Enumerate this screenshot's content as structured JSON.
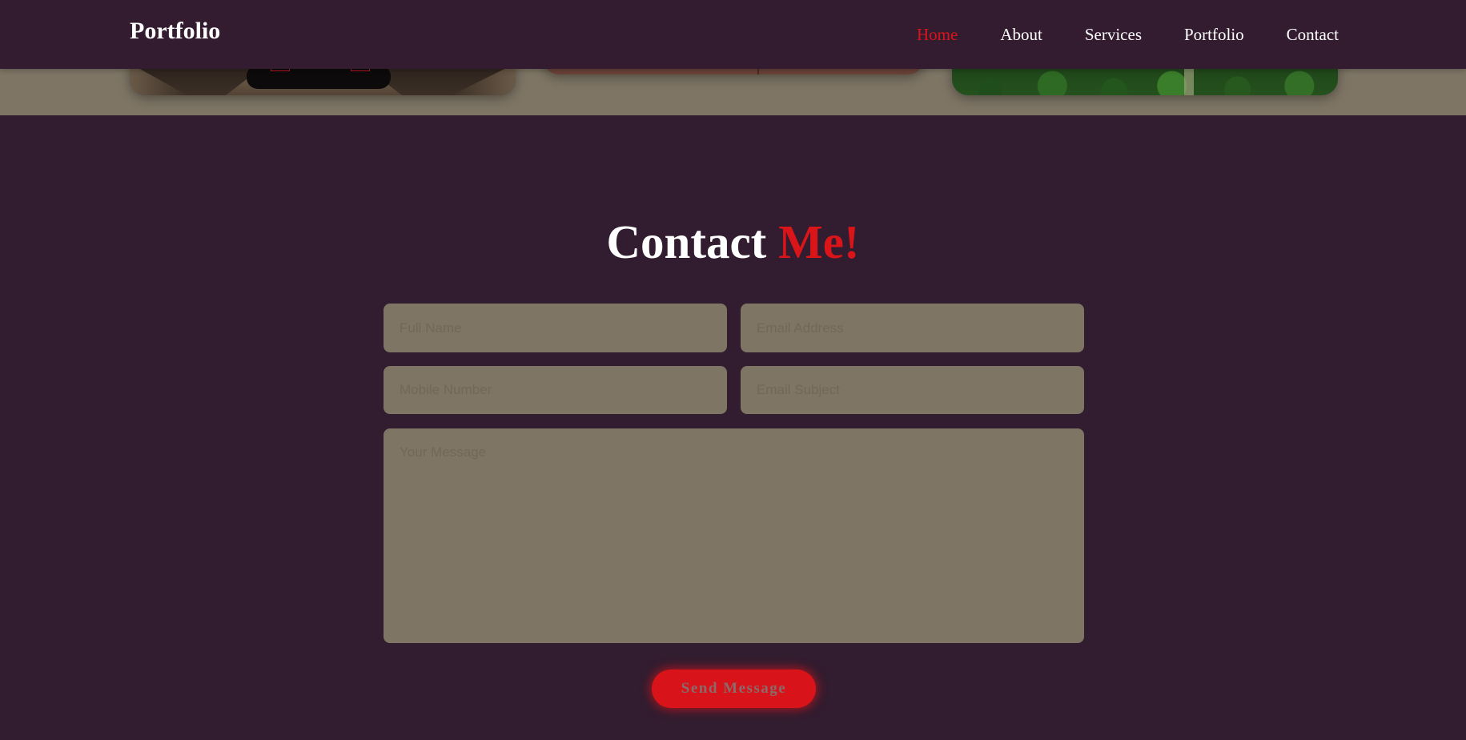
{
  "header": {
    "logo": "Portfolio",
    "nav": [
      {
        "label": "Home",
        "active": true
      },
      {
        "label": "About",
        "active": false
      },
      {
        "label": "Services",
        "active": false
      },
      {
        "label": "Portfolio",
        "active": false
      },
      {
        "label": "Contact",
        "active": false
      }
    ]
  },
  "contact": {
    "title_main": "Contact",
    "title_accent": "Me!",
    "fields": {
      "name_placeholder": "Full Name",
      "email_placeholder": "Email Address",
      "mobile_placeholder": "Mobile Number",
      "subject_placeholder": "Email Subject",
      "message_placeholder": "Your Message"
    },
    "submit_label": "Send Message"
  },
  "colors": {
    "background": "#321c2f",
    "header": "#331c30",
    "accent": "#d9151a",
    "field": "#7e7565",
    "text": "#ffffff"
  }
}
